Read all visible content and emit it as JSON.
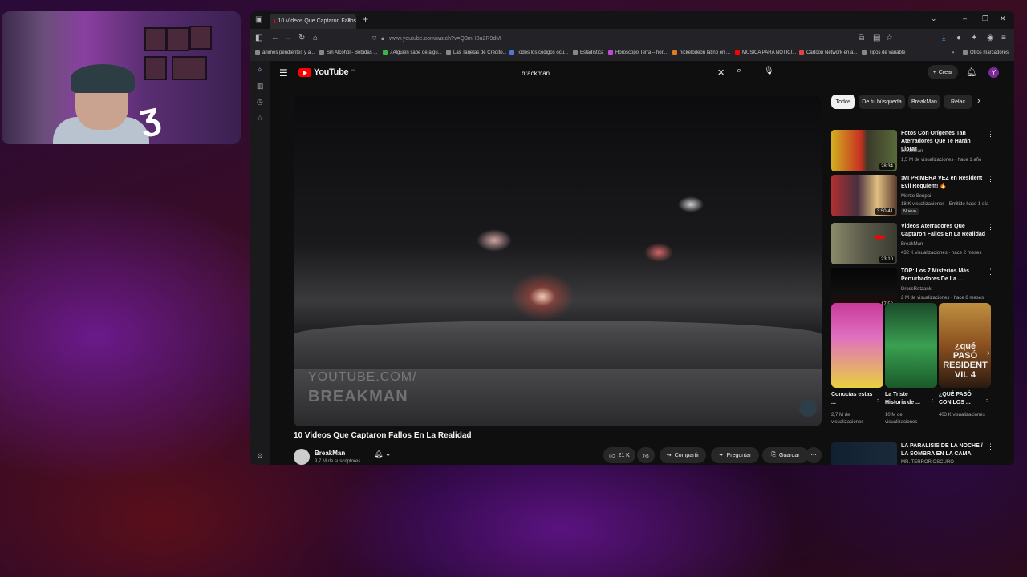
{
  "browser": {
    "tab_title": "10 Videos Que Captaron Fallos",
    "url": "www.youtube.com/watch?v=Q3mH8u2R9dM",
    "bookmarks": [
      "animes pendientes y a...",
      "Sin Alcohol - Bebidas ...",
      "¿Alguien sabe de algu...",
      "Las Tarjetas de Crédito...",
      "Todos los códigos ocu...",
      "Estadística",
      "Horoscopo Terra – hor...",
      "nickelodeon latino en ...",
      "MUSICA PARA NOTICI...",
      "Cartoon Network en a...",
      "Tipos de variable"
    ],
    "bookmarks_other": "Otros marcadores"
  },
  "youtube": {
    "logo_text": "YouTube",
    "logo_country": "MX",
    "search_value": "brackman",
    "create_label": "Crear",
    "avatar_letter": "Y"
  },
  "video": {
    "watermark_line1": "YOUTUBE.COM/",
    "watermark_line2": "BREAKMAN",
    "title": "10 Videos Que Captaron Fallos En La Realidad",
    "channel": "BreakMan",
    "subscribers": "9,7 M de suscriptores",
    "likes": "21 K",
    "share_label": "Compartir",
    "ask_label": "Preguntar",
    "save_label": "Guardar"
  },
  "sidebar": {
    "chips": [
      "Todos",
      "De tu búsqueda",
      "BreakMan",
      "Relac"
    ],
    "videos": [
      {
        "title": "Fotos Con Orígenes Tan Aterradores Que Te Harán Llorar",
        "channel": "BreakMan",
        "meta": "1,5 M de visualizaciones · hace 1 año",
        "duration": "28:34"
      },
      {
        "title": "¡MI PRIMERA VEZ en Resident Evil Requiem! 🔥",
        "channel": "Mortto Senpai",
        "meta": "18 K visualizaciones · Emitido hace 1 día",
        "duration": "3:50:41",
        "badge": "Nuevo"
      },
      {
        "title": "Videos Aterradores Que Captaron Fallos En La Realidad",
        "channel": "BreakMan",
        "meta": "432 K visualizaciones · hace 2 meses",
        "duration": "23:10"
      },
      {
        "title": "TOP: Los 7 Misterios Más Perturbadores De La ...",
        "channel": "DrossRotzank",
        "meta": "2 M de visualizaciones · hace 8 meses",
        "duration": "17:58"
      },
      {
        "title": "LA PARALISIS DE LA NOCHE / LA SOMBRA EN LA CAMA",
        "channel": "MR. TERROR OSCURO",
        "meta": "",
        "duration": ""
      }
    ],
    "shorts": [
      {
        "title": "Conocías estas ...",
        "views": "2,7 M de visualizaciones",
        "overlay": ""
      },
      {
        "title": "La Triste Historia de ...",
        "views": "10 M de visualizaciones",
        "overlay": ""
      },
      {
        "title": "¿QUÉ PASÓ CON LOS ...",
        "views": "403 K visualizaciones",
        "overlay": "¿qué PASÓ RESIDENT VIL 4"
      }
    ]
  },
  "colors": {
    "youtube_red": "#ff0000",
    "page_bg": "#0f0f0f",
    "accent_purple": "#7b2a9a"
  }
}
